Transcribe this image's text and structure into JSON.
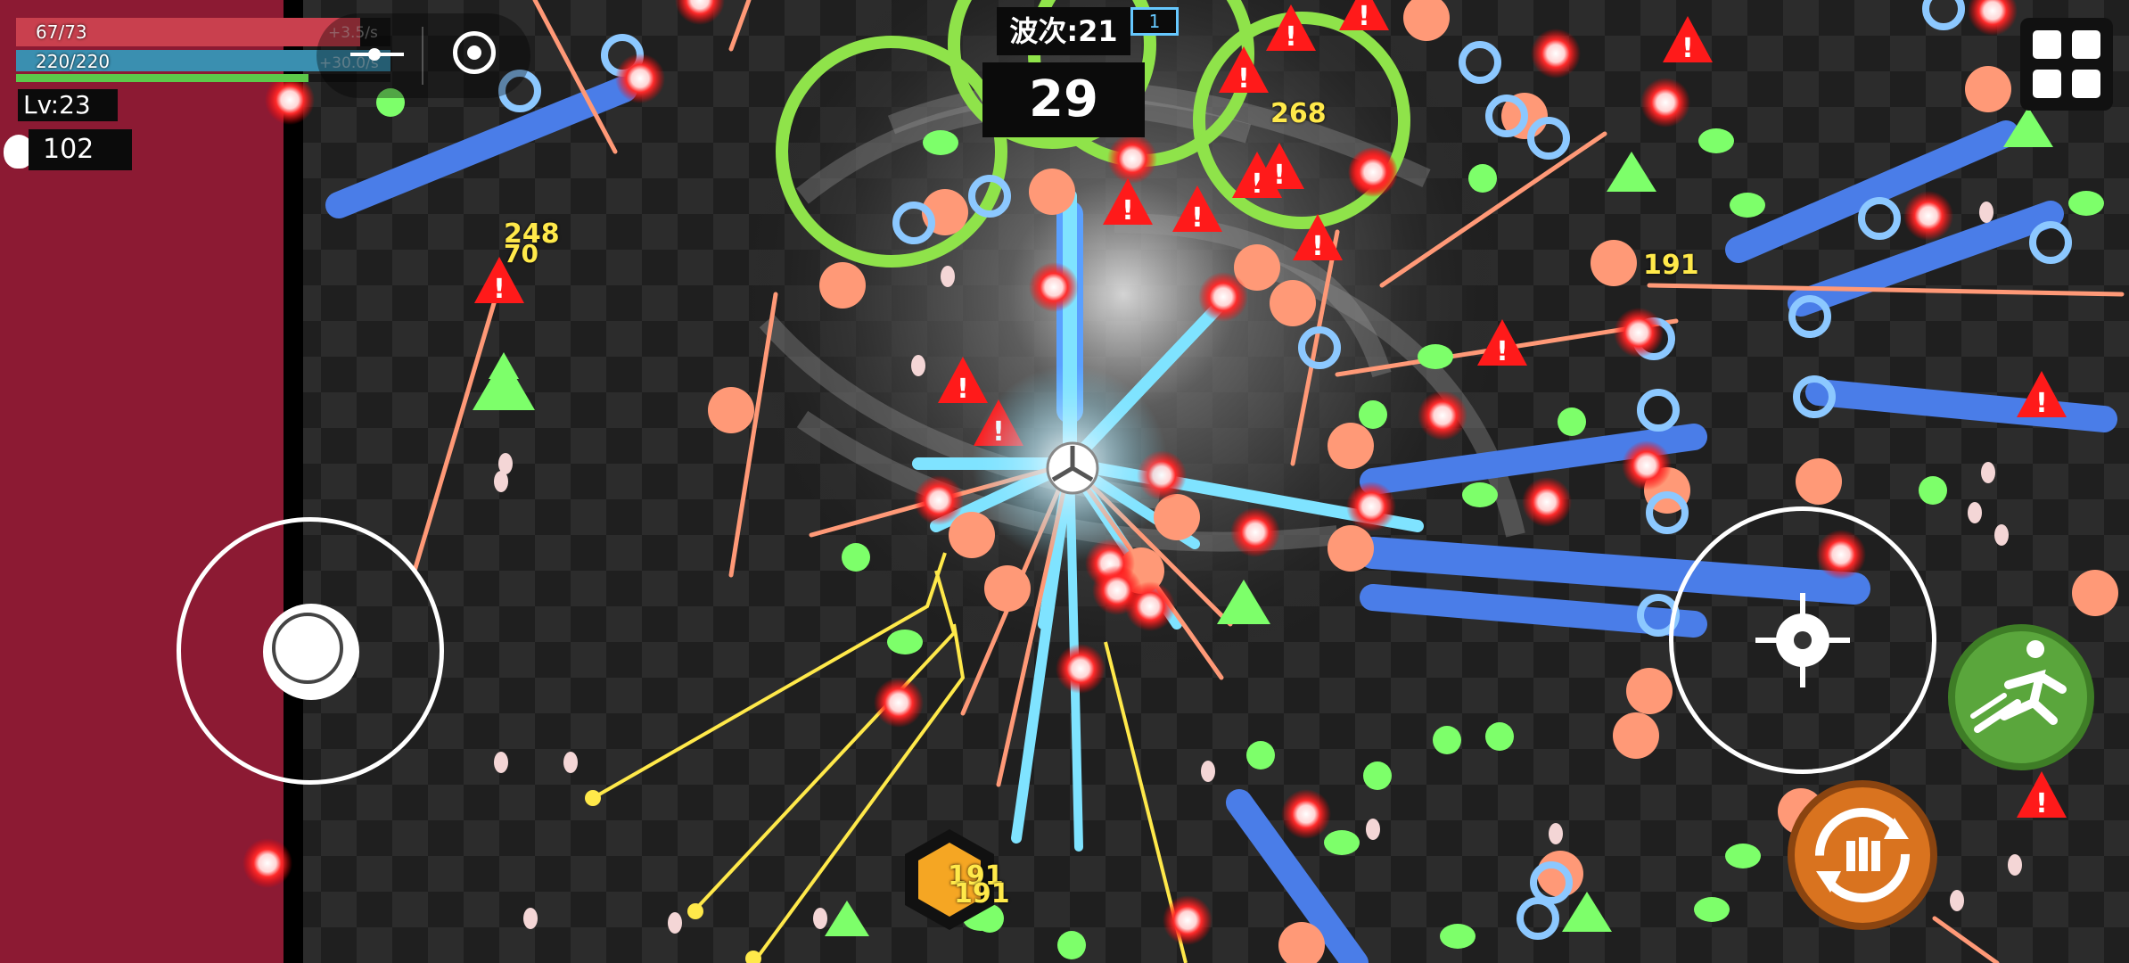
{
  "hud": {
    "hp_text": "67/73",
    "hp_fraction": 0.92,
    "hp_rate": "+3.5/s",
    "shield_text": "220/220",
    "shield_fraction": 1.0,
    "shield_rate": "+30.0/s",
    "xp_fraction": 0.78,
    "level": "Lv:23",
    "coins": "102",
    "wave_label": "波次:21",
    "wave_badge": "1",
    "timer": "29"
  },
  "damage_numbers": [
    "248",
    "70",
    "268",
    "191",
    "191",
    "191"
  ],
  "colors": {
    "danger_zone": "#8c1a33",
    "hp_bar": "#c9404e",
    "shield_bar": "#3a8fb0",
    "xp_bar": "#5cc94a",
    "enemy_red": "#ff1a1a",
    "projectile_blue": "#4a7de8",
    "projectile_cyan": "#7fe3ff",
    "green_enemy": "#7dff6a",
    "salmon": "#ff9977",
    "yellow_damage": "#ffe94a",
    "dash_button": "#5aa63c",
    "reload_button": "#d9731f"
  },
  "icons": {
    "pause_menu": "grid-2x2-icon",
    "target_lock": "target-icon",
    "dash_skill": "sprint-icon",
    "reload_skill": "reload-icon",
    "aim": "crosshair-icon"
  }
}
